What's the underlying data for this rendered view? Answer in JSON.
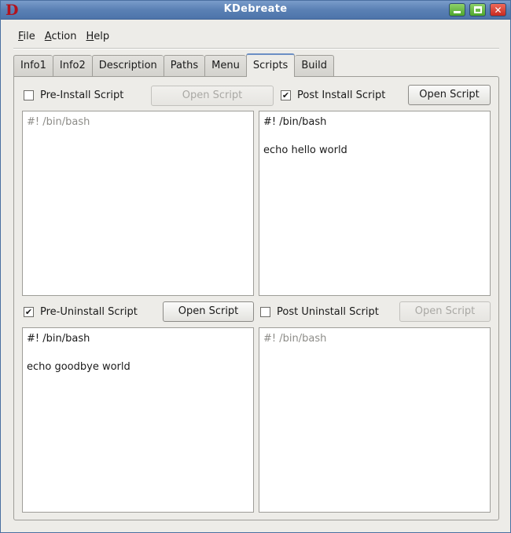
{
  "window": {
    "title": "KDebreate",
    "app_icon_letter": "D",
    "controls": [
      "minimize-icon",
      "maximize-icon",
      "close-icon"
    ]
  },
  "menu": {
    "file": {
      "accel": "F",
      "rest": "ile"
    },
    "action": {
      "accel": "A",
      "rest": "ction"
    },
    "help": {
      "accel": "H",
      "rest": "elp"
    }
  },
  "tabs": {
    "info1": "Info1",
    "info2": "Info2",
    "description": "Description",
    "paths": "Paths",
    "menu": "Menu",
    "scripts": "Scripts",
    "build": "Build",
    "active": "Scripts"
  },
  "scripts": {
    "pre_install": {
      "label": "Pre-Install Script",
      "checked": false,
      "button": "Open Script",
      "button_enabled": false,
      "content": "#! /bin/bash"
    },
    "post_install": {
      "label": "Post Install Script",
      "checked": true,
      "button": "Open Script",
      "button_enabled": true,
      "content": "#! /bin/bash\n\necho hello world"
    },
    "pre_uninstall": {
      "label": "Pre-Uninstall Script",
      "checked": true,
      "button": "Open Script",
      "button_enabled": true,
      "content": "#! /bin/bash\n\necho goodbye world"
    },
    "post_uninstall": {
      "label": "Post Uninstall Script",
      "checked": false,
      "button": "Open Script",
      "button_enabled": false,
      "content": "#! /bin/bash"
    }
  },
  "glyphs": {
    "check": "✔",
    "unchecked": ""
  },
  "colors": {
    "titlebar": "#5a80b4",
    "app_icon": "#b3121c",
    "close_button": "#c62a20",
    "minmax_button": "#4ea62c"
  }
}
